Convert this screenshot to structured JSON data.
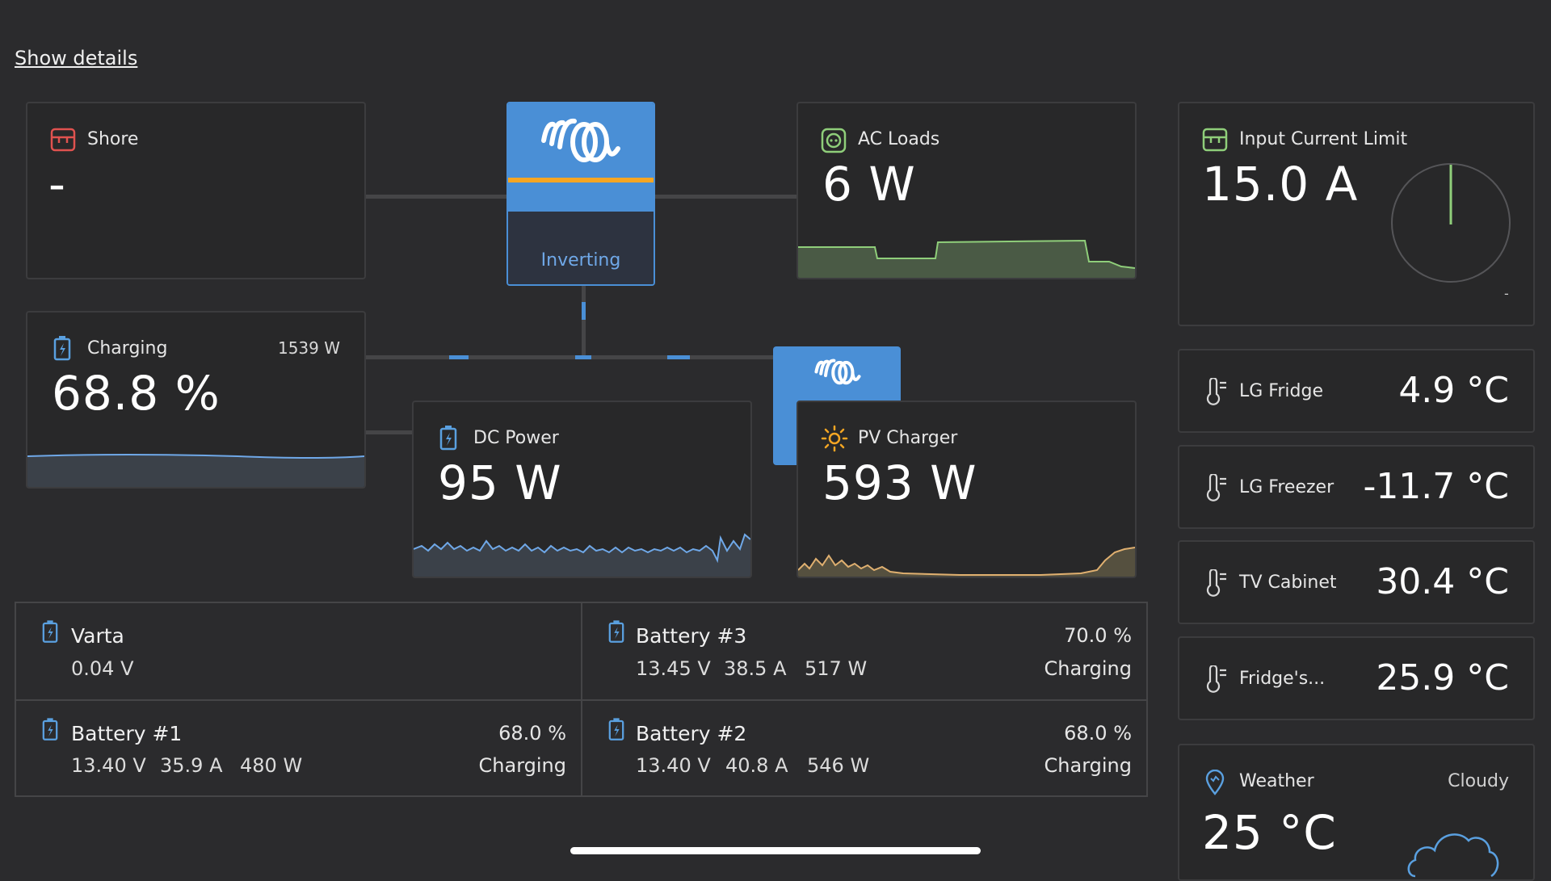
{
  "header": {
    "show_details": "Show details"
  },
  "shore": {
    "title": "Shore",
    "value": "-"
  },
  "inverter": {
    "state": "Inverting"
  },
  "ac_loads": {
    "title": "AC Loads",
    "value": "6 W"
  },
  "input_current_limit": {
    "title": "Input Current Limit",
    "value": "15.0 A",
    "gauge_min": "-"
  },
  "battery_main": {
    "title": "Charging",
    "power": "1539 W",
    "soc": "68.8 %"
  },
  "dc_power": {
    "title": "DC Power",
    "value": "95 W"
  },
  "pv_charger": {
    "title": "PV Charger",
    "value": "593 W"
  },
  "temperatures": [
    {
      "name": "LG Fridge",
      "value": "4.9 °C"
    },
    {
      "name": "LG Freezer",
      "value": "-11.7 °C"
    },
    {
      "name": "TV Cabinet",
      "value": "30.4 °C"
    },
    {
      "name": "Fridge's...",
      "value": "25.9 °C"
    }
  ],
  "weather": {
    "title": "Weather",
    "condition": "Cloudy",
    "value": "25 °C"
  },
  "batteries": [
    {
      "name": "Varta",
      "voltage": "0.04 V",
      "current": "",
      "power": "",
      "soc": "",
      "state": ""
    },
    {
      "name": "Battery #3",
      "voltage": "13.45 V",
      "current": "38.5 A",
      "power": "517 W",
      "soc": "70.0 %",
      "state": "Charging"
    },
    {
      "name": "Battery #1",
      "voltage": "13.40 V",
      "current": "35.9 A",
      "power": "480 W",
      "soc": "68.0 %",
      "state": "Charging"
    },
    {
      "name": "Battery #2",
      "voltage": "13.40 V",
      "current": "40.8 A",
      "power": "546 W",
      "soc": "68.0 %",
      "state": "Charging"
    }
  ],
  "colors": {
    "background": "#2b2b2d",
    "card": "#282829",
    "accent_blue": "#4a8fd6",
    "inverter_bar": "#f5a623",
    "ac_green": "#8fce7a",
    "shore_red": "#e0524f",
    "pv_orange": "#f5a623",
    "battery_blue": "#5aa0e0"
  }
}
